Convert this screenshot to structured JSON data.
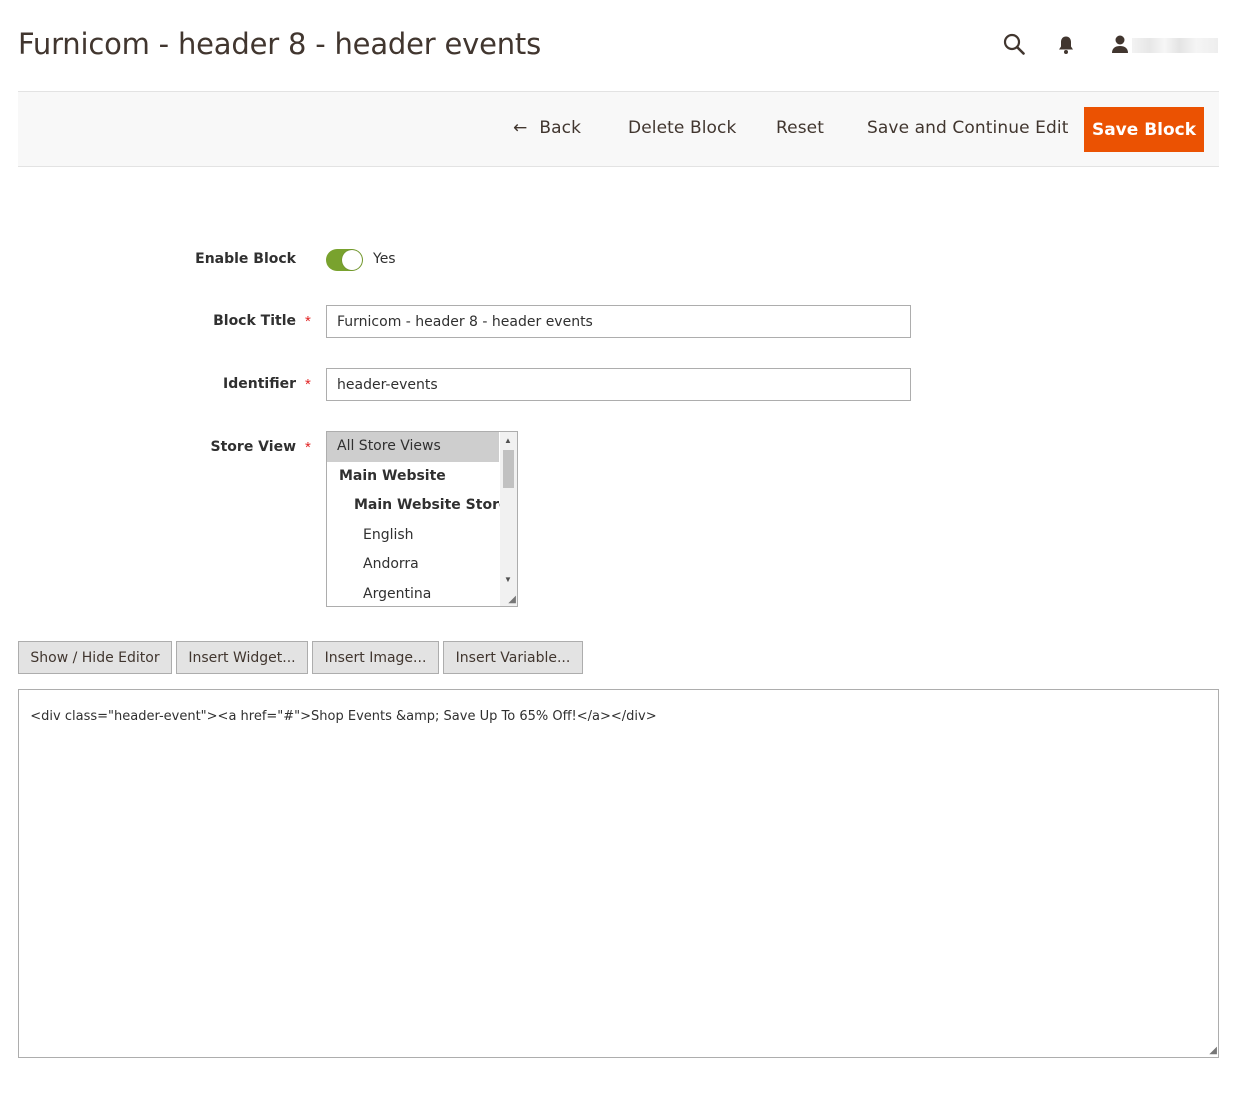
{
  "page": {
    "title": "Furnicom - header 8 - header events"
  },
  "header": {
    "search_icon": "search-icon",
    "notifications_icon": "bell-icon",
    "user_icon": "user-icon"
  },
  "actions": {
    "back_label": "Back",
    "delete_label": "Delete Block",
    "reset_label": "Reset",
    "save_continue_label": "Save and Continue Edit",
    "save_label": "Save Block",
    "save_color": "#eb5202"
  },
  "form": {
    "enable_block": {
      "label": "Enable Block",
      "value_text": "Yes",
      "enabled": true,
      "toggle_color": "#79a22e"
    },
    "block_title": {
      "label": "Block Title",
      "required_mark": "*",
      "value": "Furnicom - header 8 - header events"
    },
    "identifier": {
      "label": "Identifier",
      "required_mark": "*",
      "value": "header-events"
    },
    "store_view": {
      "label": "Store View",
      "required_mark": "*",
      "options": [
        {
          "label": "All Store Views",
          "selected": true
        },
        {
          "label": "Main Website",
          "selected": false
        },
        {
          "label": "Main Website Store",
          "selected": false
        },
        {
          "label": "English",
          "selected": false
        },
        {
          "label": "Andorra",
          "selected": false
        },
        {
          "label": "Argentina",
          "selected": false
        }
      ]
    }
  },
  "editor": {
    "show_hide_label": "Show / Hide Editor",
    "insert_widget_label": "Insert Widget...",
    "insert_image_label": "Insert Image...",
    "insert_variable_label": "Insert Variable...",
    "content": "<div class=\"header-event\"><a href=\"#\">Shop Events &amp; Save Up To 65% Off!</a></div>"
  }
}
